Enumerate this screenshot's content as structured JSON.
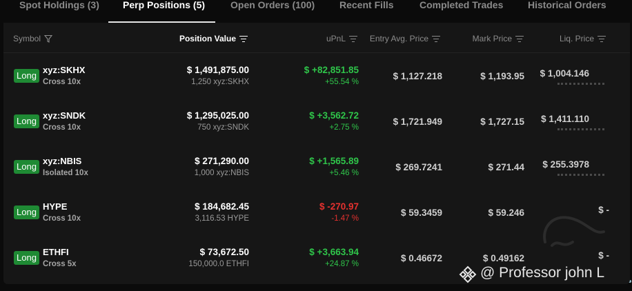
{
  "tabs": [
    {
      "label": "Spot Holdings (3)"
    },
    {
      "label": "Perp Positions (5)"
    },
    {
      "label": "Open Orders (100)"
    },
    {
      "label": "Recent Fills"
    },
    {
      "label": "Completed Trades"
    },
    {
      "label": "Historical Orders"
    }
  ],
  "active_tab": "Perp Positions (5)",
  "columns": {
    "symbol": "Symbol",
    "position_value": "Position Value",
    "upnl": "uPnL",
    "entry": "Entry Avg. Price",
    "mark": "Mark Price",
    "liq": "Liq. Price"
  },
  "rows": [
    {
      "side": "Long",
      "symbol": "xyz:SKHX",
      "margin": "Cross 10x",
      "value": "$ 1,491,875.00",
      "size": "1,250 xyz:SKHX",
      "pnl": "$ +82,851.85",
      "pnl_pct": "+55.54 %",
      "entry": "$ 1,127.218",
      "mark": "$ 1,193.95",
      "liq": "$ 1,004.146"
    },
    {
      "side": "Long",
      "symbol": "xyz:SNDK",
      "margin": "Cross 10x",
      "value": "$ 1,295,025.00",
      "size": "750 xyz:SNDK",
      "pnl": "$ +3,562.72",
      "pnl_pct": "+2.75 %",
      "entry": "$ 1,721.949",
      "mark": "$ 1,727.15",
      "liq": "$ 1,411.110"
    },
    {
      "side": "Long",
      "symbol": "xyz:NBIS",
      "margin": "Isolated 10x",
      "value": "$ 271,290.00",
      "size": "1,000 xyz:NBIS",
      "pnl": "$ +1,565.89",
      "pnl_pct": "+5.46 %",
      "entry": "$ 269.7241",
      "mark": "$ 271.44",
      "liq": "$ 255.3978"
    },
    {
      "side": "Long",
      "symbol": "HYPE",
      "margin": "Cross 10x",
      "value": "$ 184,682.45",
      "size": "3,116.53 HYPE",
      "pnl": "$ -270.97",
      "pnl_pct": "-1.47 %",
      "entry": "$ 59.3459",
      "mark": "$ 59.246",
      "liq": "$ -"
    },
    {
      "side": "Long",
      "symbol": "ETHFI",
      "margin": "Cross 5x",
      "value": "$ 73,672.50",
      "size": "150,000.0 ETHFI",
      "pnl": "$ +3,663.94",
      "pnl_pct": "+24.87 %",
      "entry": "$ 0.46672",
      "mark": "$ 0.49162",
      "liq": "$ -"
    }
  ],
  "watermark": "@ Professor john L",
  "colors": {
    "background": "#0b0b0b",
    "panel": "#161616",
    "long_badge": "#1f8a34",
    "positive": "#2fc54a",
    "negative": "#e5312f",
    "accent_bar": "#8fb8c6"
  },
  "icons": [
    "filter-icon",
    "sort-icon",
    "binance-logo-icon"
  ]
}
